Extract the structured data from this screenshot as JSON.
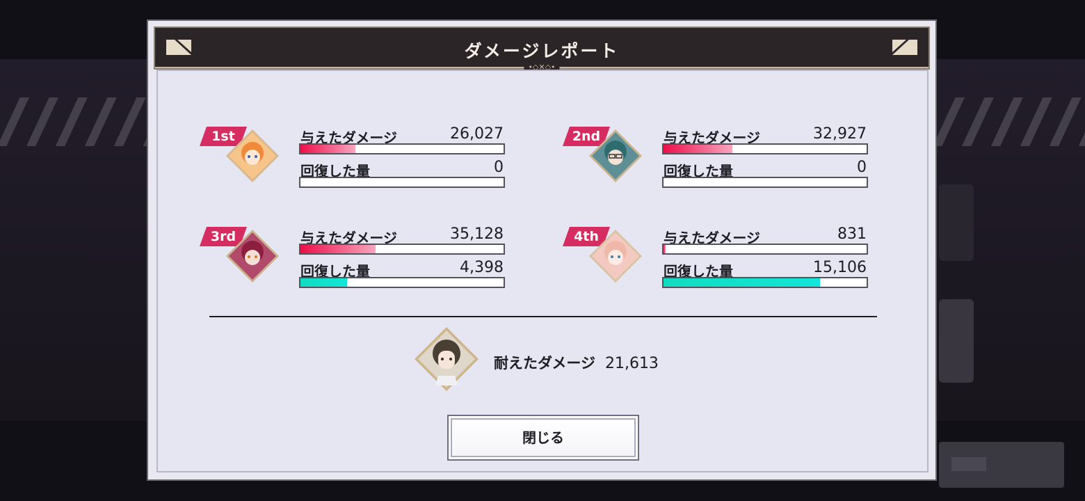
{
  "dialog": {
    "title": "ダメージレポート",
    "close_label": "閉じる"
  },
  "players": [
    {
      "rank": "1st",
      "damage_label": "与えたダメージ",
      "damage_value": "26,027",
      "damage_fraction": 0.27,
      "heal_label": "回復した量",
      "heal_value": "0",
      "heal_fraction": 0.0
    },
    {
      "rank": "2nd",
      "damage_label": "与えたダメージ",
      "damage_value": "32,927",
      "damage_fraction": 0.34,
      "heal_label": "回復した量",
      "heal_value": "0",
      "heal_fraction": 0.0
    },
    {
      "rank": "3rd",
      "damage_label": "与えたダメージ",
      "damage_value": "35,128",
      "damage_fraction": 0.37,
      "heal_label": "回復した量",
      "heal_value": "4,398",
      "heal_fraction": 0.23
    },
    {
      "rank": "4th",
      "damage_label": "与えたダメージ",
      "damage_value": "831",
      "damage_fraction": 0.01,
      "heal_label": "回復した量",
      "heal_value": "15,106",
      "heal_fraction": 0.77
    }
  ],
  "tank": {
    "label": "耐えたダメージ",
    "value": "21,613"
  },
  "colors": {
    "rank_badge": "#d52c62",
    "damage_bar": "#ec0f4a",
    "heal_bar": "#12dcc0",
    "header_bg": "#2b2528"
  },
  "icons": {
    "header_left": "corner-left-ornament-icon",
    "header_right": "corner-right-ornament-icon"
  }
}
